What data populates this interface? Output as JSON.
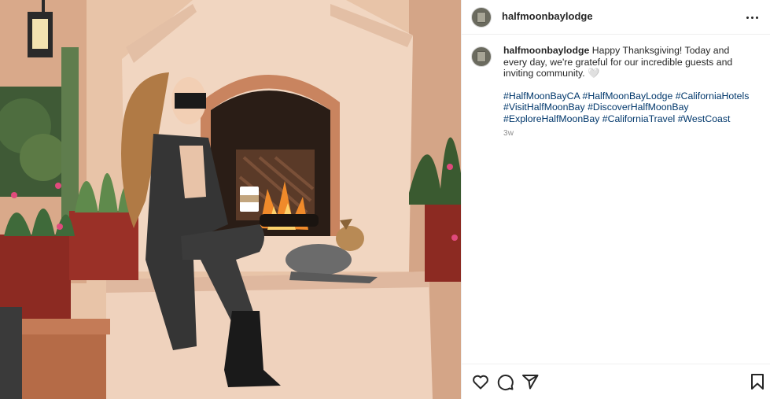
{
  "post": {
    "username": "halfmoonbaylodge",
    "caption_text": "Happy Thanksgiving! Today and every day, we're grateful for our incredible guests and inviting community. 🤍",
    "hashtags": [
      "#HalfMoonBayCA",
      "#HalfMoonBayLodge",
      "#CaliforniaHotels",
      "#VisitHalfMoonBay",
      "#DiscoverHalfMoonBay",
      "#ExploreHalfMoonBay",
      "#CaliforniaTravel",
      "#WestCoast"
    ],
    "timestamp": "3w"
  },
  "icons": {
    "more": "more-options-icon",
    "like": "heart-icon",
    "comment": "comment-icon",
    "share": "send-icon",
    "save": "bookmark-icon"
  },
  "colors": {
    "hashtag": "#00376b",
    "text": "#262626",
    "muted": "#8e8e8e"
  }
}
